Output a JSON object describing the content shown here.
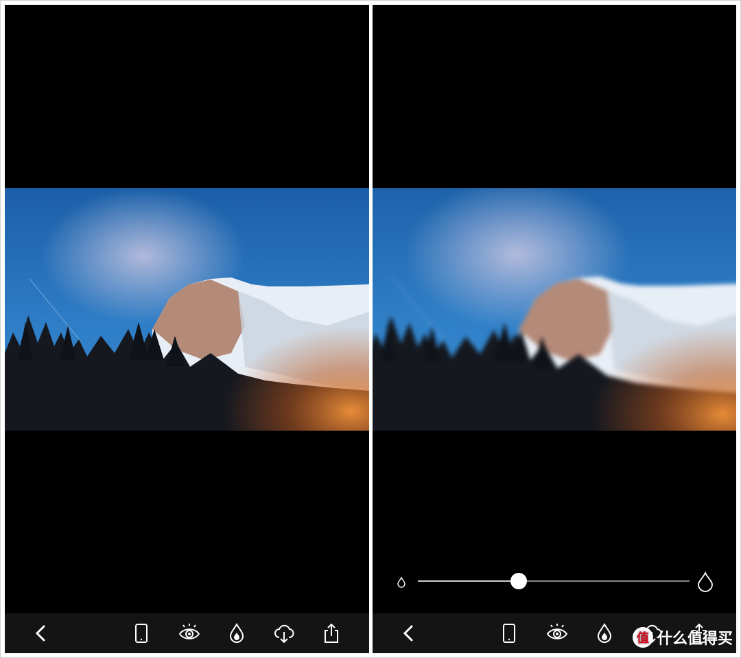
{
  "left_panel": {
    "photo_icon": "photo-preview",
    "toolbar": [
      {
        "icon": "back-chevron-icon"
      },
      {
        "icon": "phone-preview-icon"
      },
      {
        "icon": "eye-icon"
      },
      {
        "icon": "drop-icon"
      },
      {
        "icon": "cloud-download-icon"
      },
      {
        "icon": "share-icon"
      }
    ]
  },
  "right_panel": {
    "blur_slider": {
      "value": 0.37,
      "min_icon": "small-drop-icon",
      "max_icon": "large-drop-icon"
    },
    "toolbar": [
      {
        "icon": "back-chevron-icon"
      },
      {
        "icon": "phone-preview-icon"
      },
      {
        "icon": "eye-icon"
      },
      {
        "icon": "drop-icon"
      },
      {
        "icon": "cloud-download-icon"
      },
      {
        "icon": "share-icon"
      }
    ]
  },
  "watermark": {
    "badge": "值",
    "text": "什么值得买"
  },
  "colors": {
    "toolbar_bg": "#141414",
    "panel_bg": "#000000",
    "accent": "#ffffff"
  }
}
